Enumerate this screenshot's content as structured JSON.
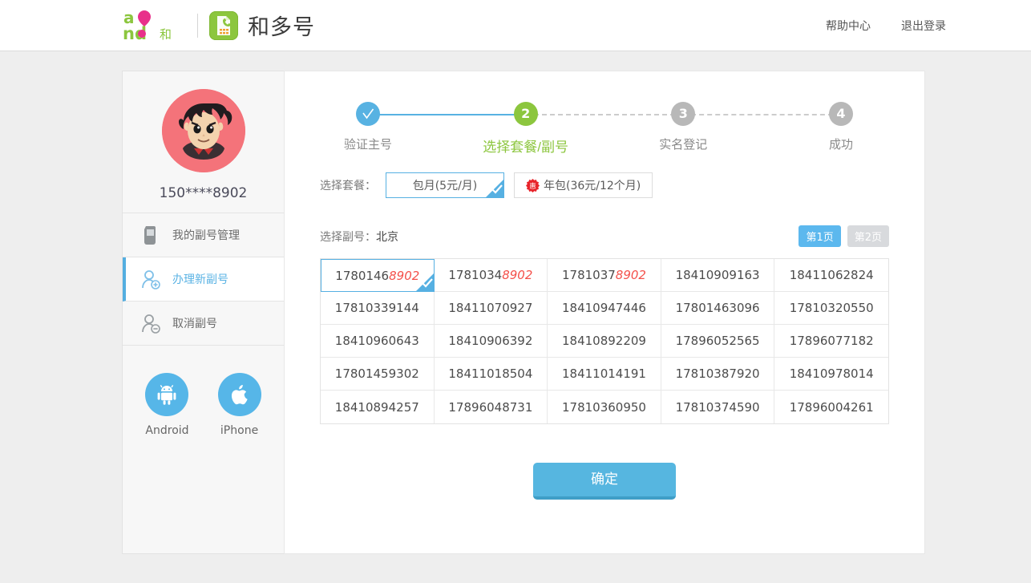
{
  "header": {
    "logo_text": "and和",
    "logo_icon": "sim-card-icon",
    "brand_name": "和多号",
    "links": [
      {
        "label": "帮助中心",
        "name": "help-center-link"
      },
      {
        "label": "退出登录",
        "name": "logout-link"
      }
    ]
  },
  "sidebar": {
    "avatar_icon": "user-avatar-cartoon",
    "account_number": "150****8902",
    "nav": [
      {
        "label": "我的副号管理",
        "icon": "mobile-phone-icon",
        "active": false
      },
      {
        "label": "办理新副号",
        "icon": "user-add-icon",
        "active": true
      },
      {
        "label": "取消副号",
        "icon": "user-remove-icon",
        "active": false
      }
    ],
    "apps": [
      {
        "label": "Android",
        "icon": "android-icon"
      },
      {
        "label": "iPhone",
        "icon": "apple-icon"
      }
    ]
  },
  "stepper": {
    "steps": [
      {
        "num": "✓",
        "label": "验证主号",
        "state": "done"
      },
      {
        "num": "2",
        "label": "选择套餐/副号",
        "state": "current"
      },
      {
        "num": "3",
        "label": "实名登记",
        "state": "todo"
      },
      {
        "num": "4",
        "label": "成功",
        "state": "todo"
      }
    ]
  },
  "plan_section": {
    "label": "选择套餐：",
    "options": [
      {
        "label": "包月(5元/月)",
        "selected": true,
        "badge": null
      },
      {
        "label": "年包(36元/12个月)",
        "selected": false,
        "badge": "惠"
      }
    ]
  },
  "number_section": {
    "label": "选择副号：",
    "city": "北京",
    "pager": [
      {
        "label": "第1页",
        "active": true
      },
      {
        "label": "第2页",
        "active": false
      }
    ],
    "highlight_suffix": "8902",
    "selected_index": 0,
    "numbers": [
      "17801468902",
      "17810348902",
      "17810378902",
      "18410909163",
      "18411062824",
      "17810339144",
      "18411070927",
      "18410947446",
      "17801463096",
      "17810320550",
      "18410960643",
      "18410906392",
      "18410892209",
      "17896052565",
      "17896077182",
      "17801459302",
      "18411018504",
      "18411014191",
      "17810387920",
      "18410978014",
      "18410894257",
      "17896048731",
      "17810360950",
      "17810374590",
      "17896004261"
    ]
  },
  "confirm_button": {
    "label": "确定"
  },
  "colors": {
    "page_bg": "#eeeeee",
    "accent_blue": "#56b0e2",
    "accent_green": "#8cc63e",
    "highlight_red": "#f4504a",
    "step_gray": "#b8b8b8",
    "avatar_bg": "#f4737a"
  }
}
